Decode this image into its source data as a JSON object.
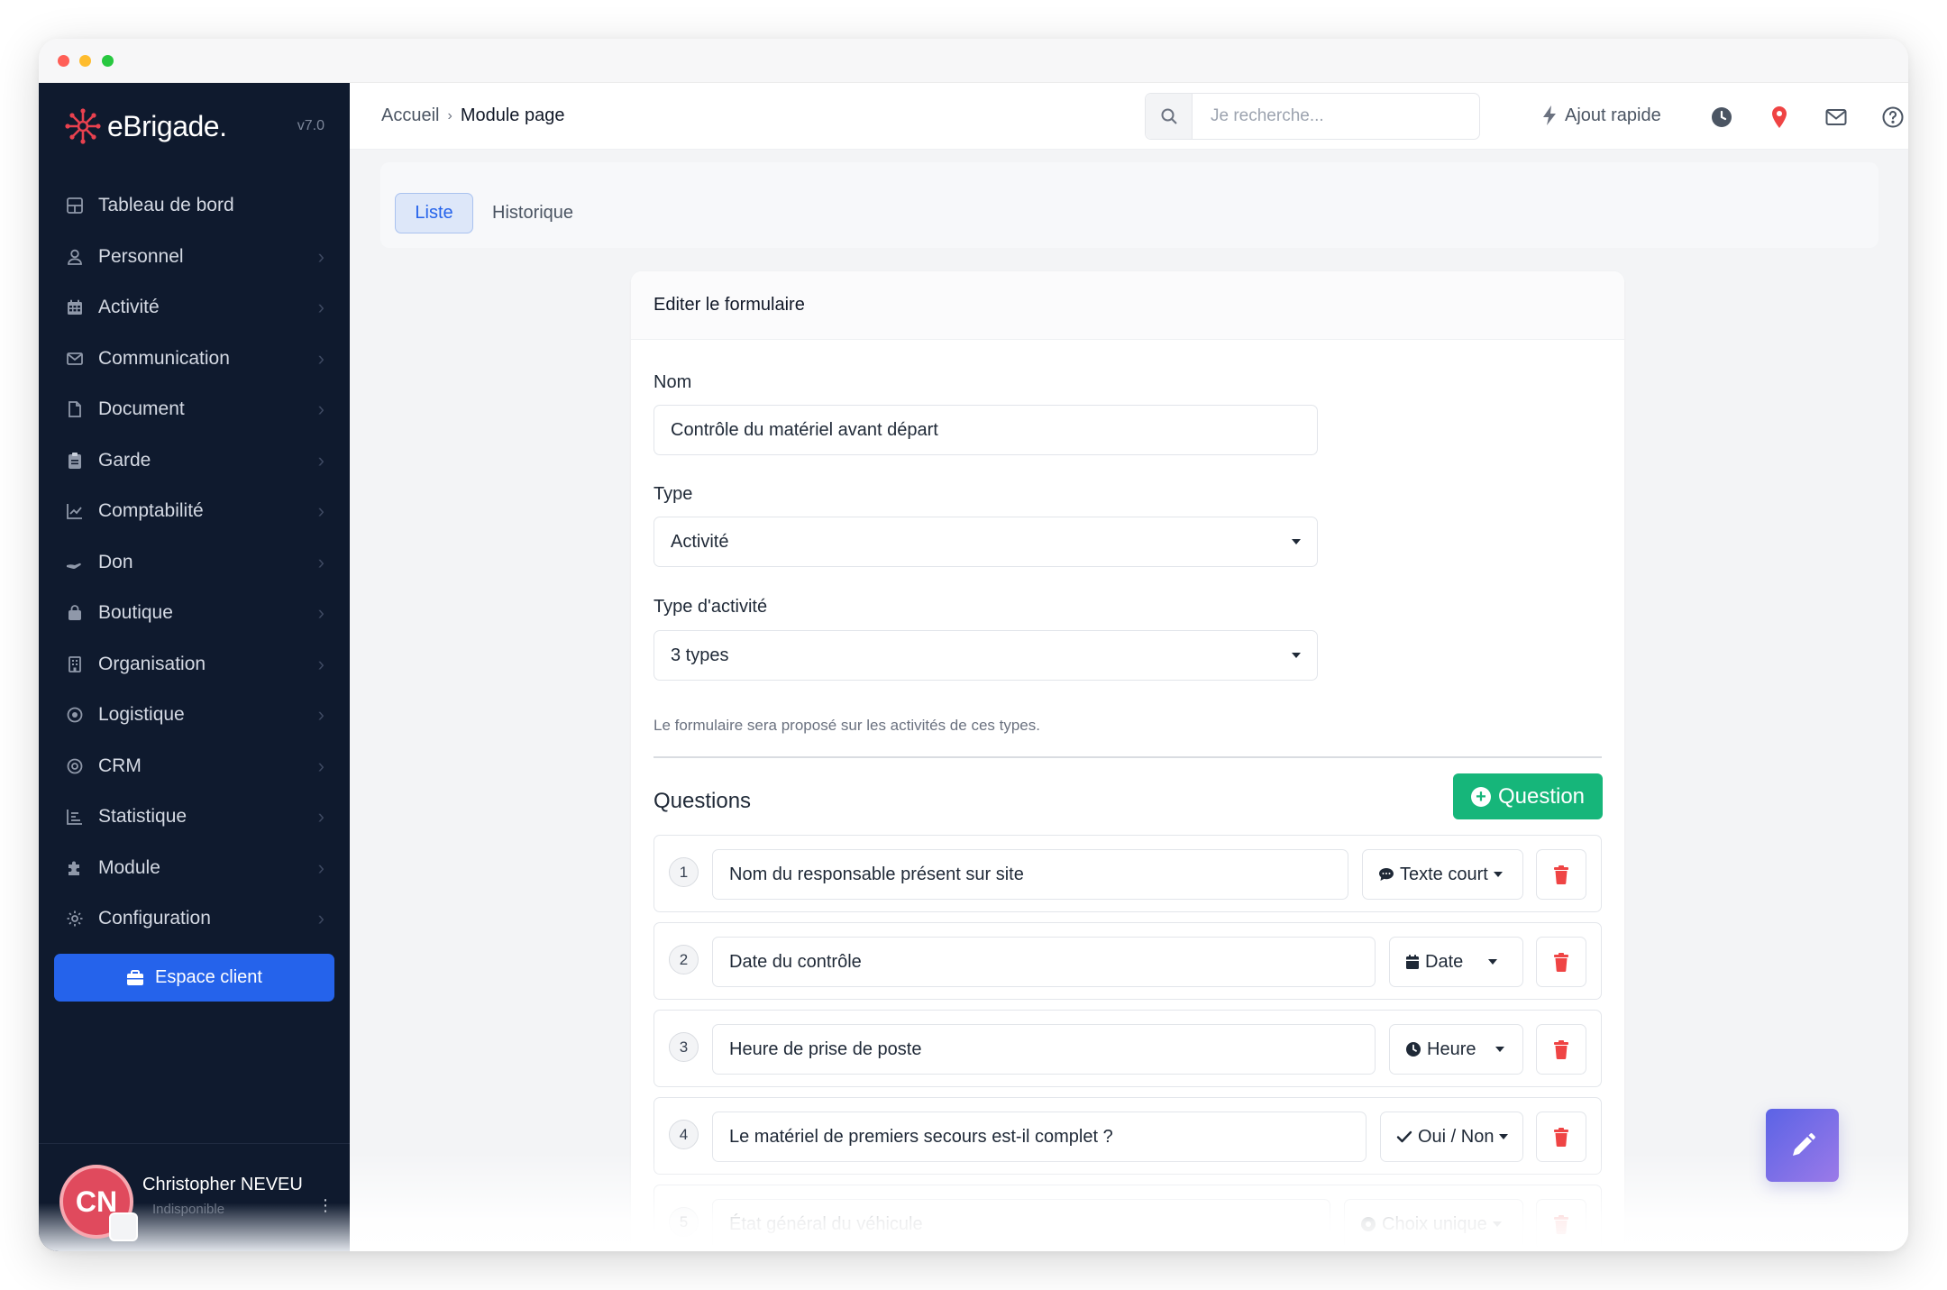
{
  "app": {
    "logo_text": "eBrigade.",
    "version": "v7.0",
    "brand_color": "#e8414f",
    "accent_color": "#2563eb"
  },
  "sidebar": {
    "items": [
      {
        "label": "Tableau de bord",
        "icon": "dashboard-icon",
        "has_submenu": false
      },
      {
        "label": "Personnel",
        "icon": "user-icon",
        "has_submenu": true
      },
      {
        "label": "Activité",
        "icon": "calendar-icon",
        "has_submenu": true
      },
      {
        "label": "Communication",
        "icon": "envelope-icon",
        "has_submenu": true
      },
      {
        "label": "Document",
        "icon": "file-icon",
        "has_submenu": true
      },
      {
        "label": "Garde",
        "icon": "clipboard-icon",
        "has_submenu": true
      },
      {
        "label": "Comptabilité",
        "icon": "chart-line-icon",
        "has_submenu": true
      },
      {
        "label": "Don",
        "icon": "hand-holding-icon",
        "has_submenu": true
      },
      {
        "label": "Boutique",
        "icon": "shopping-bag-icon",
        "has_submenu": true
      },
      {
        "label": "Organisation",
        "icon": "building-icon",
        "has_submenu": true
      },
      {
        "label": "Logistique",
        "icon": "circle-dot-icon",
        "has_submenu": true
      },
      {
        "label": "CRM",
        "icon": "at-sign-icon",
        "has_submenu": true
      },
      {
        "label": "Statistique",
        "icon": "bar-chart-icon",
        "has_submenu": true
      },
      {
        "label": "Module",
        "icon": "puzzle-icon",
        "has_submenu": true
      },
      {
        "label": "Configuration",
        "icon": "gear-icon",
        "has_submenu": true
      }
    ],
    "client_button": "Espace client",
    "user": {
      "initials": "CN",
      "name": "Christopher NEVEU",
      "status": "Indisponible"
    }
  },
  "topbar": {
    "breadcrumb": {
      "home": "Accueil",
      "separator": "›",
      "current": "Module page"
    },
    "search_placeholder": "Je recherche...",
    "quick_add": "Ajout rapide",
    "icons": [
      "clock-icon",
      "map-pin-icon",
      "mail-icon",
      "help-icon"
    ]
  },
  "tabs": [
    {
      "label": "Liste",
      "active": true
    },
    {
      "label": "Historique",
      "active": false
    }
  ],
  "form": {
    "title": "Editer le formulaire",
    "name_label": "Nom",
    "name_value": "Contrôle du matériel avant départ",
    "type_label": "Type",
    "type_value": "Activité",
    "activity_type_label": "Type d'activité",
    "activity_type_value": "3 types",
    "help_text": "Le formulaire sera proposé sur les activités de ces types.",
    "questions_title": "Questions",
    "add_question_label": "Question",
    "questions": [
      {
        "num": "1",
        "text": "Nom du responsable présent sur site",
        "type": "Texte court",
        "type_icon": "comment-icon"
      },
      {
        "num": "2",
        "text": "Date du contrôle",
        "type": "Date",
        "type_icon": "calendar-icon"
      },
      {
        "num": "3",
        "text": "Heure de prise de poste",
        "type": "Heure",
        "type_icon": "clock-icon"
      },
      {
        "num": "4",
        "text": "Le matériel de premiers secours est-il complet ?",
        "type": "Oui / Non",
        "type_icon": "check-icon"
      },
      {
        "num": "5",
        "text": "État général du véhicule",
        "type": "Choix unique",
        "type_icon": "radio-icon"
      }
    ]
  },
  "colors": {
    "sidebar_bg": "#0f1a2e",
    "success": "#16b67a",
    "danger": "#ef4444"
  }
}
